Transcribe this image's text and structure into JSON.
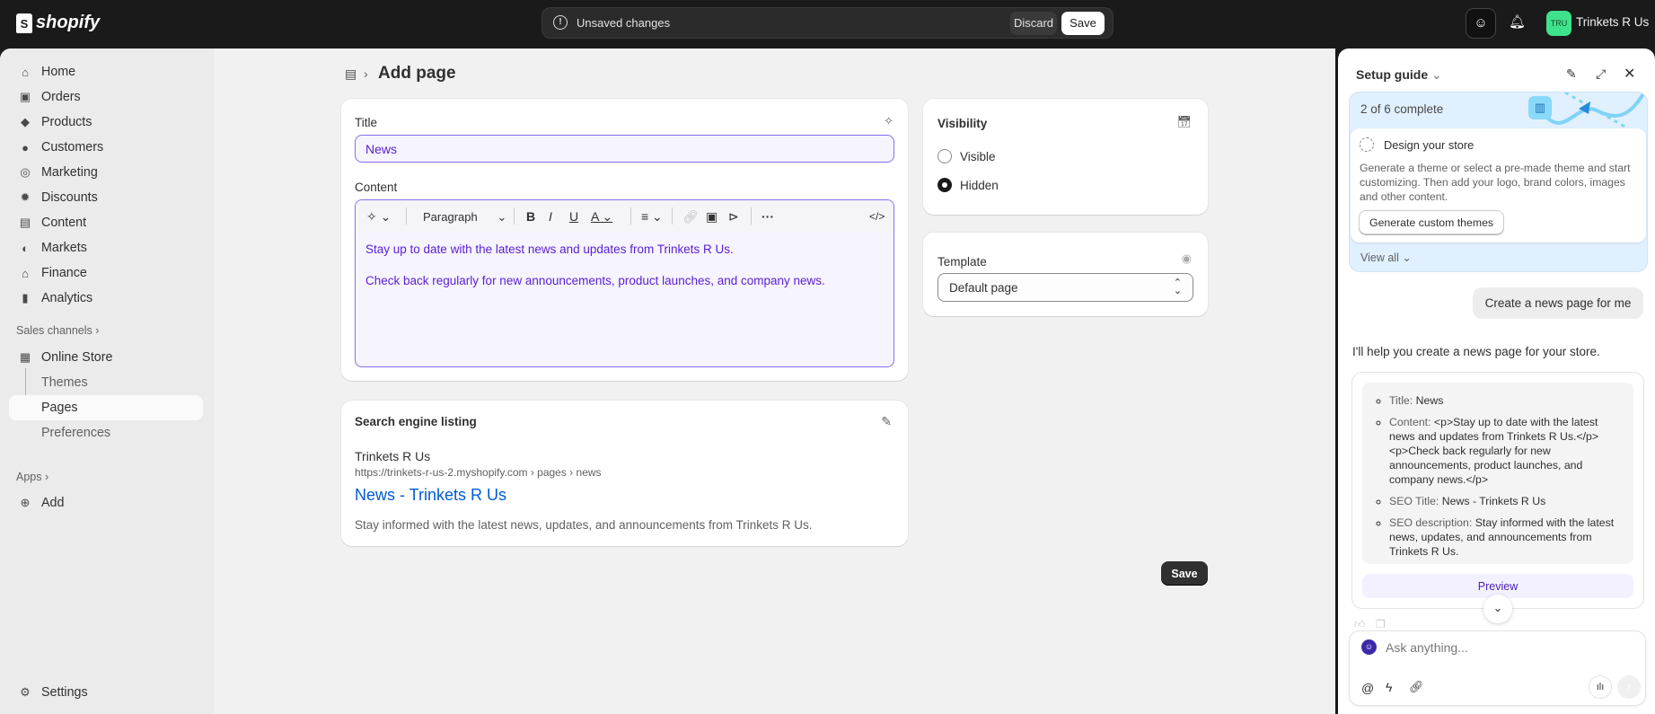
{
  "topbar": {
    "logo_text": "shopify",
    "unsaved_text": "Unsaved changes",
    "discard_label": "Discard",
    "save_label": "Save",
    "store_initials": "TRU",
    "store_name": "Trinkets R Us",
    "store_badge_color": "#3ee28c"
  },
  "sidebar": {
    "items": [
      {
        "label": "Home",
        "icon": "home-icon"
      },
      {
        "label": "Orders",
        "icon": "inbox-icon"
      },
      {
        "label": "Products",
        "icon": "tag-icon"
      },
      {
        "label": "Customers",
        "icon": "person-icon"
      },
      {
        "label": "Marketing",
        "icon": "target-icon"
      },
      {
        "label": "Discounts",
        "icon": "discount-icon"
      },
      {
        "label": "Content",
        "icon": "image-icon"
      },
      {
        "label": "Markets",
        "icon": "globe-icon"
      },
      {
        "label": "Finance",
        "icon": "bank-icon"
      },
      {
        "label": "Analytics",
        "icon": "bar-chart-icon"
      }
    ],
    "sales_channels_label": "Sales channels",
    "online_store_label": "Online Store",
    "online_store_subitems": [
      "Themes",
      "Pages",
      "Preferences"
    ],
    "selected_subitem": "Pages",
    "apps_label": "Apps",
    "add_label": "Add",
    "settings_label": "Settings"
  },
  "page": {
    "title": "Add page",
    "title_field": {
      "label": "Title",
      "value": "News"
    },
    "content_field": {
      "label": "Content",
      "format_select": "Paragraph",
      "paragraphs": [
        "Stay up to date with the latest news and updates from Trinkets R Us.",
        "Check back regularly for new announcements, product launches, and company news."
      ]
    },
    "seo": {
      "heading": "Search engine listing",
      "store_name": "Trinkets R Us",
      "url": "https://trinkets-r-us-2.myshopify.com › pages › news",
      "seo_title": "News - Trinkets R Us",
      "seo_description": "Stay informed with the latest news, updates, and announcements from Trinkets R Us."
    },
    "visibility": {
      "heading": "Visibility",
      "options": [
        "Visible",
        "Hidden"
      ],
      "selected": "Hidden"
    },
    "template": {
      "label": "Template",
      "value": "Default page"
    },
    "save_label": "Save"
  },
  "assistant": {
    "header_title": "Setup guide",
    "progress_text": "2 of 6 complete",
    "progress": {
      "completed": 2,
      "total": 6
    },
    "task": {
      "title": "Design your store",
      "description": "Generate a theme or select a pre-made theme and start customizing. Then add your logo, brand colors, images and other content.",
      "button_label": "Generate custom themes"
    },
    "view_all_label": "View all",
    "user_message": "Create a news page for me",
    "reply_intro": "I'll help you create a news page for your store.",
    "details": [
      {
        "key": "Title:",
        "value": "News"
      },
      {
        "key": "Content:",
        "value": "<p>Stay up to date with the latest news and updates from Trinkets R Us.</p><p>Check back regularly for new announcements, product launches, and company news.</p>"
      },
      {
        "key": "SEO Title:",
        "value": "News - Trinkets R Us"
      },
      {
        "key": "SEO description:",
        "value": "Stay informed with the latest news, updates, and announcements from Trinkets R Us."
      }
    ],
    "preview_label": "Preview",
    "input_placeholder": "Ask anything..."
  }
}
